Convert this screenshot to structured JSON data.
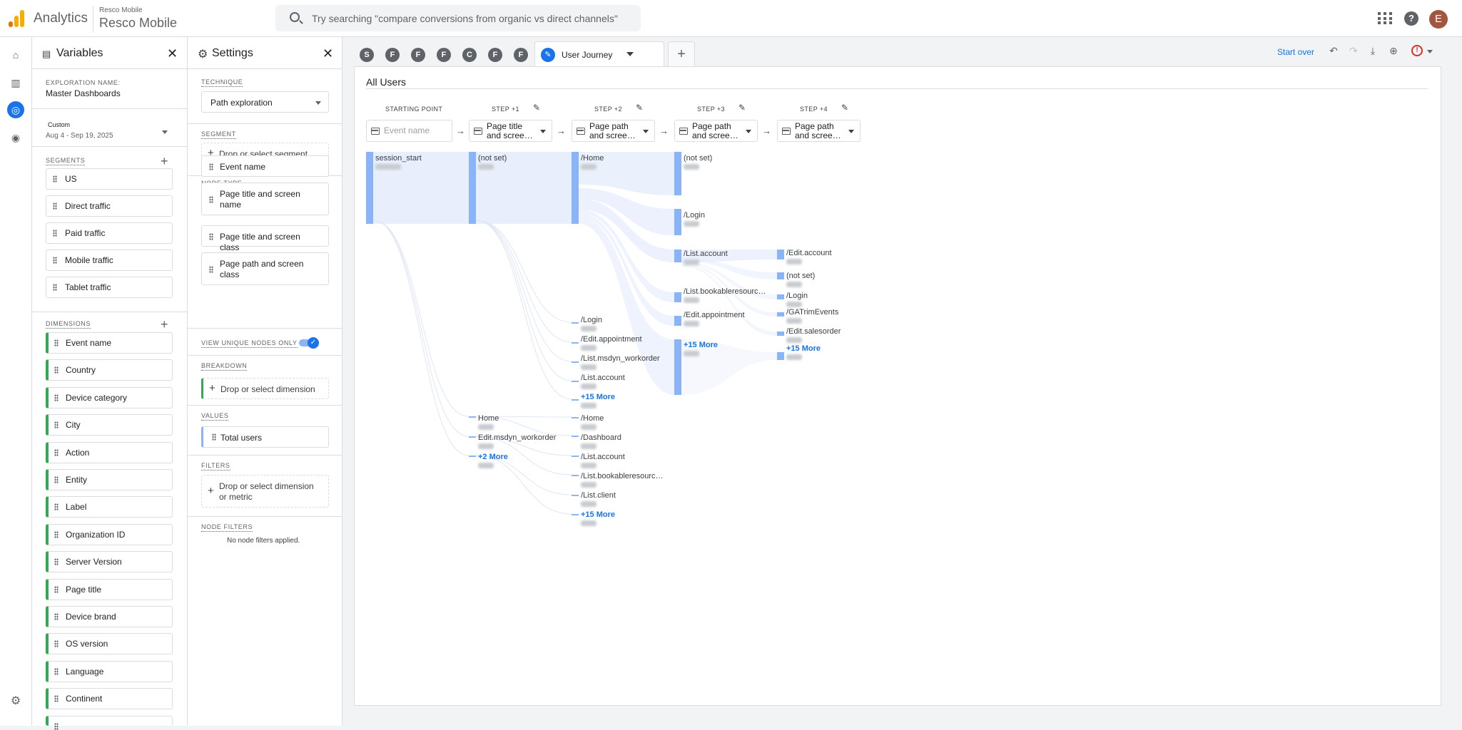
{
  "header": {
    "brand": "Analytics",
    "account_small": "Resco Mobile",
    "account_big": "Resco Mobile",
    "search_placeholder": "Try searching \"compare conversions from organic vs direct channels\"",
    "avatar_letter": "E"
  },
  "variables": {
    "title": "Variables",
    "exploration_name_label": "EXPLORATION NAME:",
    "exploration_name": "Master Dashboards",
    "date_label": "Custom",
    "date_range": "Aug 4 - Sep 19, 2025",
    "segments_label": "SEGMENTS",
    "segments": [
      "US",
      "Direct traffic",
      "Paid traffic",
      "Mobile traffic",
      "Tablet traffic"
    ],
    "dimensions_label": "DIMENSIONS",
    "dimensions": [
      "Event name",
      "Country",
      "Device category",
      "City",
      "Action",
      "Entity",
      "Label",
      "Organization ID",
      "Server Version",
      "Page title",
      "Device brand",
      "OS version",
      "Language",
      "Continent"
    ]
  },
  "settings": {
    "title": "Settings",
    "technique_label": "TECHNIQUE",
    "technique": "Path exploration",
    "segment_label": "SEGMENT",
    "segment_drop": "Drop or select segment",
    "node_type_label": "NODE TYPE",
    "node_types": [
      "Event name",
      "Page title and screen name",
      "Page title and screen class",
      "Page path and screen class"
    ],
    "view_unique_label": "VIEW UNIQUE NODES ONLY",
    "breakdown_label": "BREAKDOWN",
    "breakdown_drop": "Drop or select dimension",
    "values_label": "VALUES",
    "values_item": "Total users",
    "filters_label": "FILTERS",
    "filters_drop": "Drop or select dimension or metric",
    "node_filters_label": "NODE FILTERS",
    "node_filters_text": "No node filters applied."
  },
  "tabs": {
    "circles": [
      "S",
      "F",
      "F",
      "F",
      "C",
      "F",
      "F"
    ],
    "active_label": "User Journey"
  },
  "toolbar": {
    "start_over": "Start over"
  },
  "card": {
    "title": "All Users",
    "steps": [
      {
        "label": "STARTING POINT",
        "value": "Event name",
        "placeholder": true
      },
      {
        "label": "STEP +1",
        "value": "Page title and scree…",
        "placeholder": false
      },
      {
        "label": "STEP +2",
        "value": "Page path and scree…",
        "placeholder": false
      },
      {
        "label": "STEP +3",
        "value": "Page path and scree…",
        "placeholder": false
      },
      {
        "label": "STEP +4",
        "value": "Page path and scree…",
        "placeholder": false
      }
    ],
    "nodes": {
      "c0": [
        "session_start"
      ],
      "c1": [
        "(not set)",
        "Home",
        "Edit.msdyn_workorder",
        "+2 More"
      ],
      "c2": [
        "/Home",
        "/Login",
        "/Edit.appointment",
        "/List.msdyn_workorder",
        "/List.account",
        "+15 More",
        "/Home",
        "/Dashboard",
        "/List.account",
        "/List.bookableresourc…",
        "/List.client",
        "+15 More"
      ],
      "c3": [
        "(not set)",
        "/Login",
        "/List.account",
        "/List.bookableresourc…",
        "/Edit.appointment",
        "+15 More"
      ],
      "c4": [
        "/Edit.account",
        "(not set)",
        "/Login",
        "/GATrimEvents",
        "/Edit.salesorder",
        "+15 More"
      ]
    }
  },
  "colors": {
    "accent": "#1a73e8",
    "node_bar": "#8ab4f8",
    "dimension_bar": "#34a853",
    "alert": "#d93025"
  },
  "icons": [
    "search-icon",
    "apps-icon",
    "help-icon",
    "home-icon",
    "reports-icon",
    "explore-icon",
    "advertising-icon",
    "settings-gear-icon",
    "variables-icon",
    "close-icon",
    "gear-icon",
    "pencil-icon",
    "undo-icon",
    "redo-icon",
    "download-icon",
    "share-icon",
    "alert-icon",
    "arrow-right-icon"
  ]
}
